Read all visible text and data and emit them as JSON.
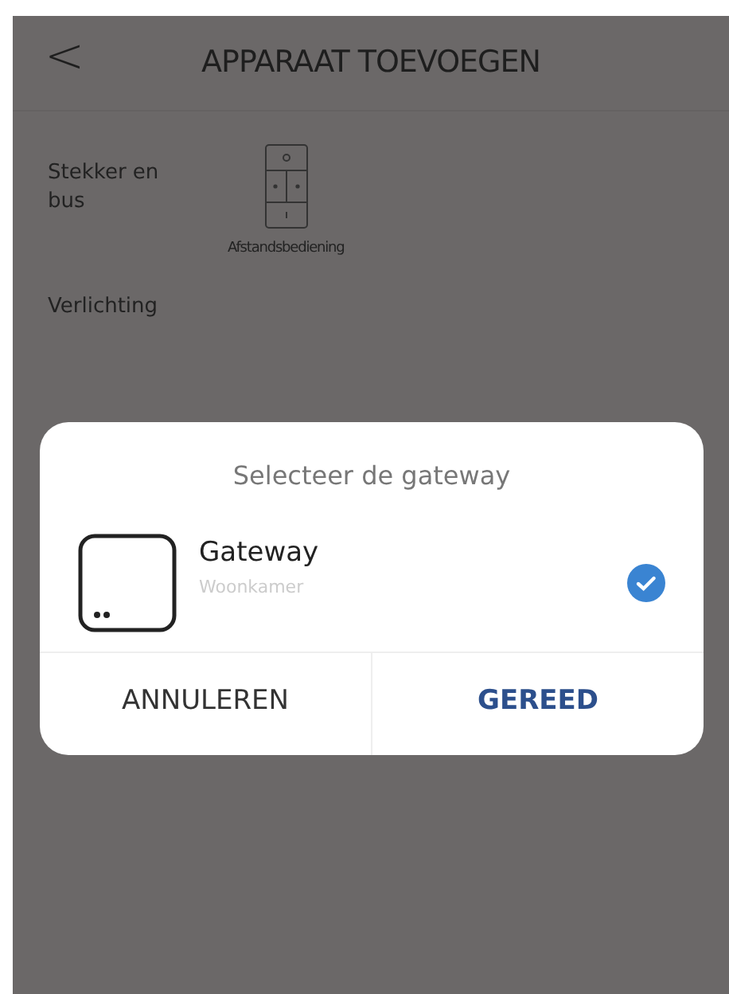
{
  "header": {
    "back": "<",
    "title": "APPARAAT TOEVOEGEN"
  },
  "categories": [
    {
      "label": "Stekker en bus"
    },
    {
      "label": "Verlichting"
    }
  ],
  "devices": [
    {
      "label": "Afstandsbediening"
    }
  ],
  "dialog": {
    "title": "Selecteer de gateway",
    "gateways": [
      {
        "name": "Gateway",
        "room": "Woonkamer",
        "selected": true
      }
    ],
    "buttons": [
      {
        "label": "ANNULEREN",
        "kind": "cancel"
      },
      {
        "label": "GEREED",
        "kind": "confirm"
      }
    ]
  }
}
